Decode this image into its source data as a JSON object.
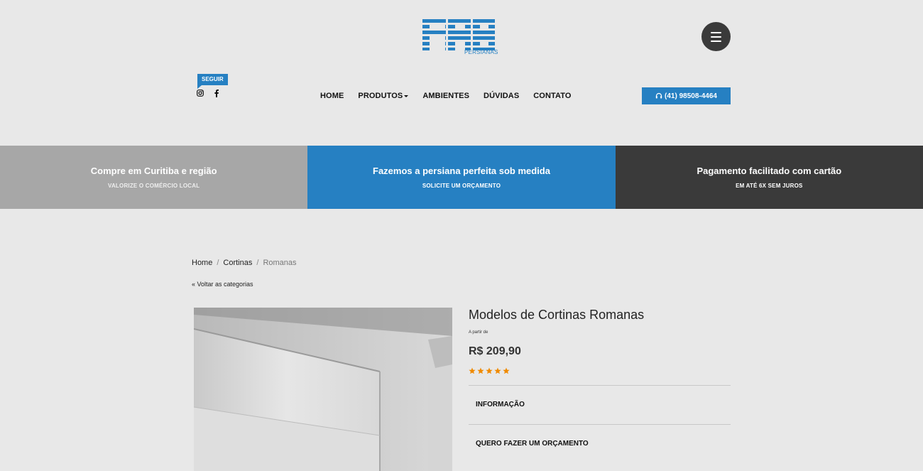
{
  "brand": {
    "logo_text": "FAB",
    "sub": "PERSIANAS",
    "color": "#2680c2"
  },
  "header": {
    "menu_icon": "hamburger-icon",
    "follow_label": "SEGUIR",
    "social": [
      "instagram-icon",
      "facebook-icon"
    ],
    "nav": [
      {
        "label": "HOME"
      },
      {
        "label": "PRODUTOS",
        "dropdown": true
      },
      {
        "label": "AMBIENTES"
      },
      {
        "label": "DÚVIDAS"
      },
      {
        "label": "CONTATO"
      }
    ],
    "phone": "(41) 98508-4464",
    "phone_icon": "headset-icon"
  },
  "strip": [
    {
      "title": "Compre em Curitiba e região",
      "subtitle": "VALORIZE O COMÉRCIO LOCAL",
      "color": "#a7a7a7"
    },
    {
      "title": "Fazemos a persiana perfeita sob medida",
      "subtitle": "SOLICITE UM ORÇAMENTO",
      "color": "#2680c2"
    },
    {
      "title": "Pagamento facilitado com cartão",
      "subtitle": "EM ATÉ 6X SEM JUROS",
      "color": "#3a3a3a"
    }
  ],
  "breadcrumb": {
    "items": [
      "Home",
      "Cortinas"
    ],
    "current": "Romanas"
  },
  "back_link": "« Voltar as categorias",
  "product": {
    "title": "Modelos de Cortinas Romanas",
    "price_prefix": "A partir de",
    "price": "R$ 209,90",
    "rating": 5,
    "star_color": "#f08a00",
    "sections": [
      "INFORMAÇÃO",
      "QUERO FAZER UM ORÇAMENTO"
    ]
  }
}
